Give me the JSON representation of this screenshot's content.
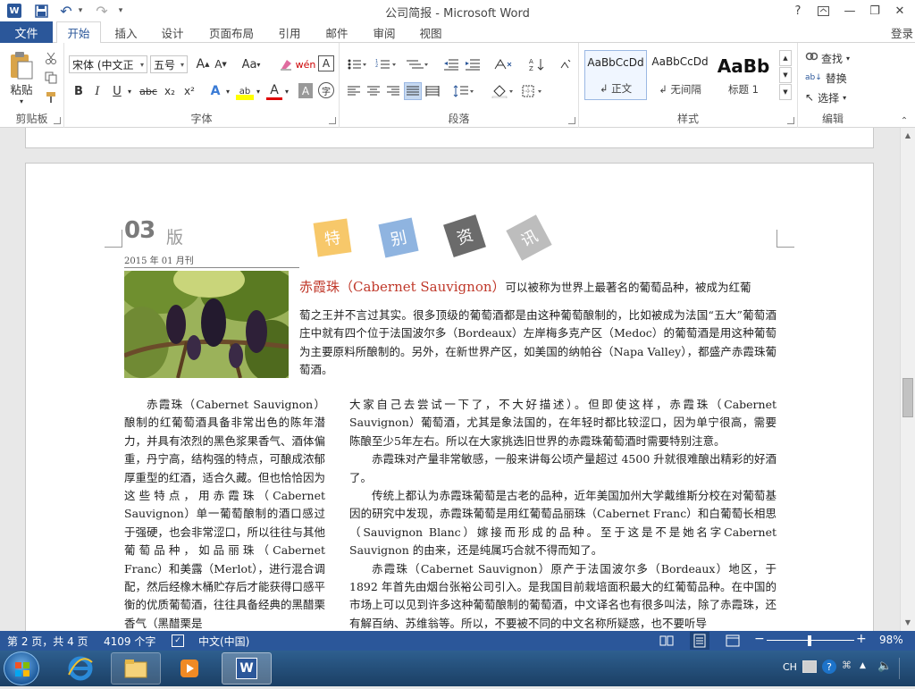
{
  "window": {
    "title": "公司简报 - Microsoft Word",
    "help": "?",
    "buttons": [
      "?",
      "⊟",
      "—",
      "❐",
      "✕"
    ]
  },
  "quick_access": {
    "word_icon": "W",
    "save": "save-icon",
    "undo": "↶",
    "redo": "↷",
    "customize": "▾"
  },
  "tabs": {
    "file": "文件",
    "items": [
      "开始",
      "插入",
      "设计",
      "页面布局",
      "引用",
      "邮件",
      "审阅",
      "视图"
    ],
    "active": "开始",
    "login": "登录"
  },
  "ribbon": {
    "clipboard": {
      "label": "剪贴板",
      "paste": "粘贴"
    },
    "font": {
      "label": "字体",
      "font_name": "宋体 (中文正",
      "font_size": "五号",
      "aa": "Aa",
      "grow": "A",
      "shrink": "A",
      "wen": "wén",
      "boxA": "A",
      "bold": "B",
      "italic": "I",
      "underline": "U",
      "strike": "abc",
      "sub": "x₂",
      "sup": "x²",
      "effects": "A",
      "highlight": "ab",
      "color": "A",
      "shade": "A",
      "circle": "字"
    },
    "paragraph": {
      "label": "段落"
    },
    "styles": {
      "label": "样式",
      "items": [
        {
          "preview": "AaBbCcDd",
          "name": "正文"
        },
        {
          "preview": "AaBbCcDd",
          "name": "无间隔"
        },
        {
          "preview": "AaBb",
          "name": "标题 1"
        }
      ]
    },
    "editing": {
      "label": "编辑",
      "find": "查找",
      "replace": "替换",
      "select": "选择"
    }
  },
  "document": {
    "issue": "03",
    "issue_suffix": "版",
    "date": "2015 年 01 月刊",
    "badges": [
      {
        "char": "特",
        "color": "#f7c86a"
      },
      {
        "char": "别",
        "color": "#8fb4e0"
      },
      {
        "char": "资",
        "color": "#6b6b6b"
      },
      {
        "char": "讯",
        "color": "#bdbdbd"
      }
    ],
    "lead_title": "赤霞珠（Cabernet Sauvignon）",
    "lead_text_1": "可以被称为世界上最著名的葡萄品种，被成为红葡",
    "lead_paragraph": "萄之王并不言过其实。很多顶级的葡萄酒都是由这种葡萄酿制的，比如被成为法国“五大”葡萄酒庄中就有四个位于法国波尔多（Bordeaux）左岸梅多克产区（Medoc）的葡萄酒是用这种葡萄为主要原料所酿制的。另外，在新世界产区，如美国的纳帕谷（Napa Valley），都盛产赤霞珠葡萄酒。",
    "col_left": "赤霞珠（Cabernet Sauvignon）酿制的红葡萄酒具备非常出色的陈年潜力，并具有浓烈的黑色浆果香气、酒体偏重，丹宁高，结构强的特点，可酿成浓郁厚重型的红酒，适合久藏。但也恰恰因为这些特点，用赤霞珠（Cabernet Sauvignon）单一葡萄酿制的酒口感过于强硬，也会非常涩口，所以往往与其他葡萄品种，如品丽珠（Cabernet Franc）和美露（Merlot），进行混合调配，然后经橡木桶贮存后才能获得口感平衡的优质葡萄酒，往往具备经典的黑醋栗香气（黑醋栗是",
    "col_right_p1": "大家自己去尝试一下了，不大好描述）。但即使这样，赤霞珠（Cabernet Sauvignon）葡萄酒，尤其是象法国的，在年轻时都比较涩口，因为单宁很高，需要陈酿至少5年左右。所以在大家挑选旧世界的赤霞珠葡萄酒时需要特别注意。",
    "col_right_p2": "赤霞珠对产量非常敏感，一般来讲每公顷产量超过 4500 升就很难酿出精彩的好酒了。",
    "col_right_p3": "传统上都认为赤霞珠葡萄是古老的品种，近年美国加州大学戴维斯分校在对葡萄基因的研究中发现，赤霞珠葡萄是用红葡萄品丽珠（Cabernet Franc）和白葡萄长相思（Sauvignon Blanc）嫁接而形成的品种。至于这是不是她名字Cabernet Sauvignon 的由来，还是纯属巧合就不得而知了。",
    "col_right_p4": "赤霞珠（Cabernet Sauvignon）原产于法国波尔多（Bordeaux）地区，于 1892 年首先由烟台张裕公司引入。是我国目前栽培面积最大的红葡萄品种。在中国的市场上可以见到许多这种葡萄酿制的葡萄酒，中文译名也有很多叫法，除了赤霞珠，还有解百纳、苏维翁等。所以，不要被不同的中文名称所疑惑，也不要听导"
  },
  "status": {
    "page": "第 2 页，共 4 页",
    "words": "4109 个字",
    "lang": "中文(中国)",
    "zoom": "98%",
    "zoom_level": 0.49
  },
  "taskbar": {
    "lang": "CH"
  }
}
